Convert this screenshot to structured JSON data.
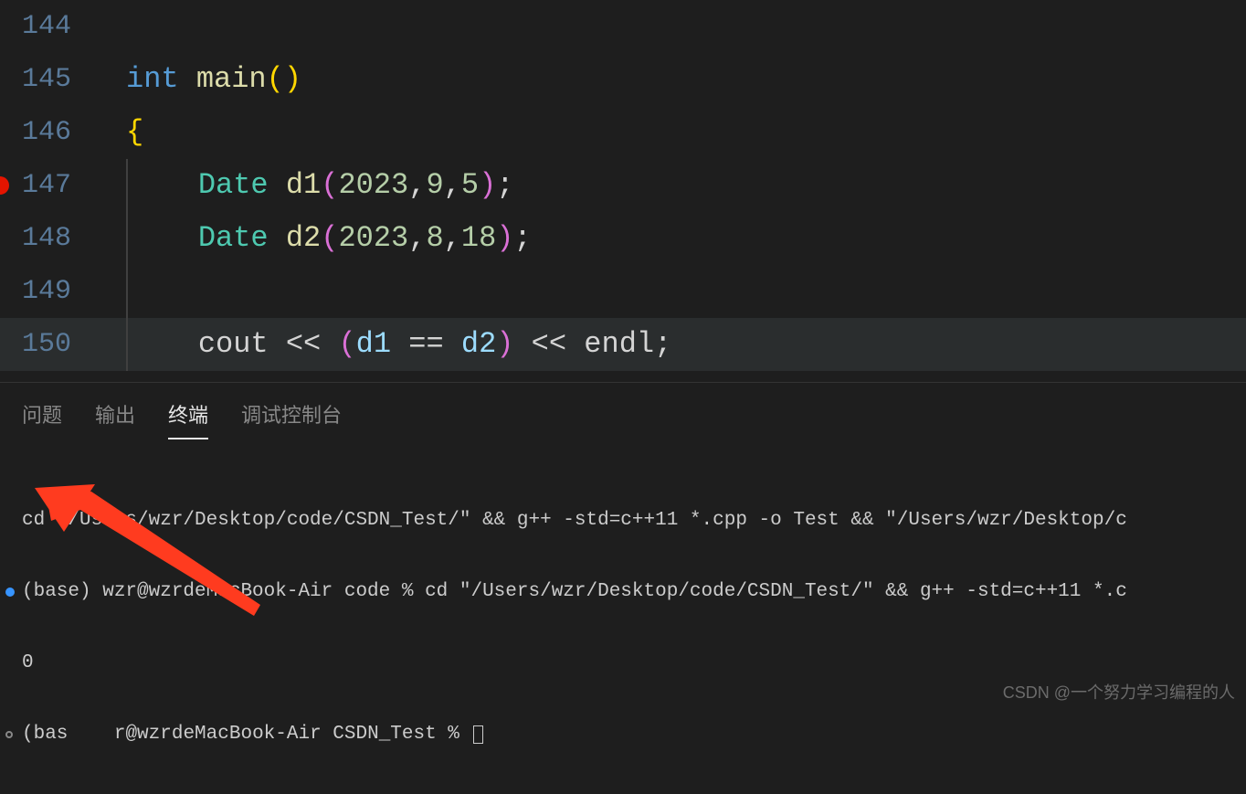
{
  "editor": {
    "lines": [
      {
        "num": "144",
        "tokens": []
      },
      {
        "num": "145",
        "tokens": [
          {
            "t": "int ",
            "c": "tok-keyword"
          },
          {
            "t": "main",
            "c": "tok-func"
          },
          {
            "t": "(",
            "c": "tok-paren-y"
          },
          {
            "t": ")",
            "c": "tok-paren-y"
          }
        ]
      },
      {
        "num": "146",
        "tokens": [
          {
            "t": "{",
            "c": "tok-paren-y"
          }
        ]
      },
      {
        "num": "147",
        "breakpoint": true,
        "indent": true,
        "tokens": [
          {
            "t": "    ",
            "c": ""
          },
          {
            "t": "Date ",
            "c": "tok-type"
          },
          {
            "t": "d1",
            "c": "tok-func"
          },
          {
            "t": "(",
            "c": "tok-paren-p"
          },
          {
            "t": "2023",
            "c": "tok-num"
          },
          {
            "t": ",",
            "c": "tok-punc"
          },
          {
            "t": "9",
            "c": "tok-num"
          },
          {
            "t": ",",
            "c": "tok-punc"
          },
          {
            "t": "5",
            "c": "tok-num"
          },
          {
            "t": ")",
            "c": "tok-paren-p"
          },
          {
            "t": ";",
            "c": "tok-punc"
          }
        ]
      },
      {
        "num": "148",
        "indent": true,
        "tokens": [
          {
            "t": "    ",
            "c": ""
          },
          {
            "t": "Date ",
            "c": "tok-type"
          },
          {
            "t": "d2",
            "c": "tok-func"
          },
          {
            "t": "(",
            "c": "tok-paren-p"
          },
          {
            "t": "2023",
            "c": "tok-num"
          },
          {
            "t": ",",
            "c": "tok-punc"
          },
          {
            "t": "8",
            "c": "tok-num"
          },
          {
            "t": ",",
            "c": "tok-punc"
          },
          {
            "t": "18",
            "c": "tok-num"
          },
          {
            "t": ")",
            "c": "tok-paren-p"
          },
          {
            "t": ";",
            "c": "tok-punc"
          }
        ]
      },
      {
        "num": "149",
        "indent": true,
        "tokens": []
      },
      {
        "num": "150",
        "indent": true,
        "highlighted": true,
        "tokens": [
          {
            "t": "    ",
            "c": ""
          },
          {
            "t": "cout ",
            "c": "tok-ident"
          },
          {
            "t": "<< ",
            "c": "tok-op"
          },
          {
            "t": "(",
            "c": "tok-paren-p"
          },
          {
            "t": "d1 ",
            "c": "tok-var"
          },
          {
            "t": "== ",
            "c": "tok-op"
          },
          {
            "t": "d2",
            "c": "tok-var"
          },
          {
            "t": ")",
            "c": "tok-paren-p"
          },
          {
            "t": " << ",
            "c": "tok-op"
          },
          {
            "t": "endl",
            "c": "tok-ident"
          },
          {
            "t": ";",
            "c": "tok-punc"
          }
        ]
      }
    ]
  },
  "panel": {
    "tabs": {
      "problems": "问题",
      "output": "输出",
      "terminal": "终端",
      "debug": "调试控制台"
    },
    "terminal": {
      "line1": "cd \"/Users/wzr/Desktop/code/CSDN_Test/\" && g++ -std=c++11 *.cpp -o Test && \"/Users/wzr/Desktop/c",
      "line2": "(base) wzr@wzrdeMacBook-Air code % cd \"/Users/wzr/Desktop/code/CSDN_Test/\" && g++ -std=c++11 *.c",
      "line3": "0",
      "line4_a": "(bas",
      "line4_b": "r@wzrdeMacBook-Air CSDN_Test % "
    }
  },
  "watermark": "CSDN @一个努力学习编程的人"
}
